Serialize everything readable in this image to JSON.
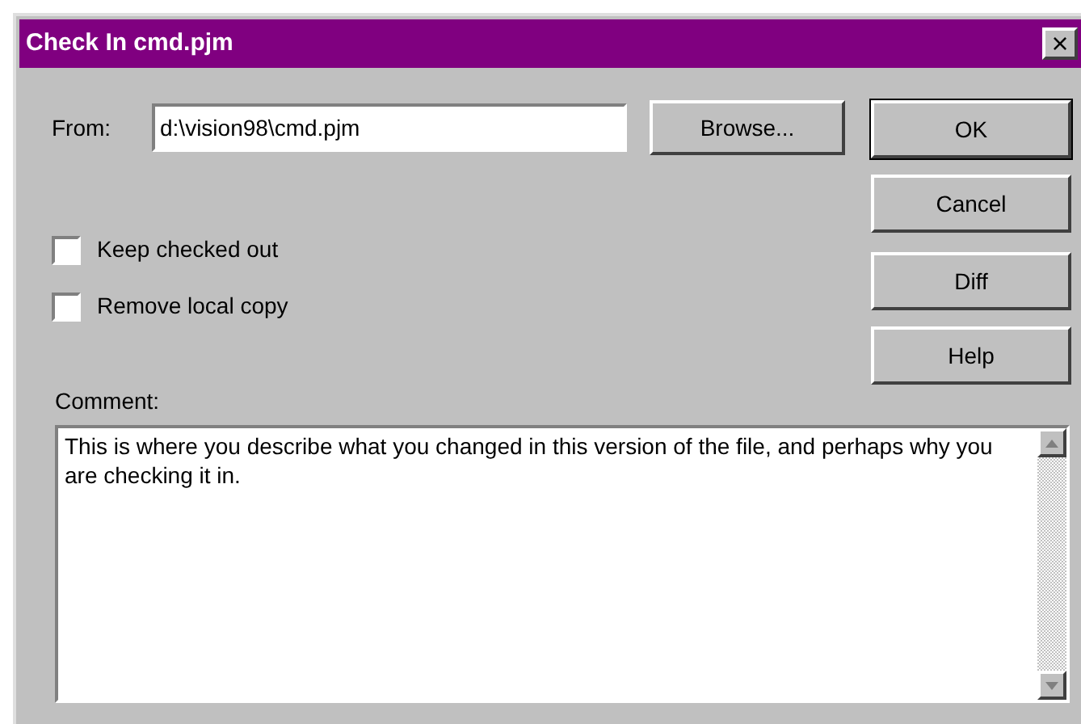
{
  "window": {
    "title": "Check In cmd.pjm",
    "close": "×"
  },
  "from": {
    "label": "From:",
    "value": "d:\\vision98\\cmd.pjm"
  },
  "browse": {
    "label": "Browse..."
  },
  "buttons": [
    {
      "label": "OK",
      "default": true
    },
    {
      "label": "Cancel",
      "default": false
    },
    {
      "label": "Diff",
      "default": false
    },
    {
      "label": "Help",
      "default": false
    }
  ],
  "options": [
    {
      "label": "Keep checked out",
      "checked": false
    },
    {
      "label": "Remove local copy",
      "checked": false
    }
  ],
  "comment": {
    "label": "Comment:",
    "value": "This is where you describe what you changed in this version of the file, and perhaps why you are checking it in."
  }
}
